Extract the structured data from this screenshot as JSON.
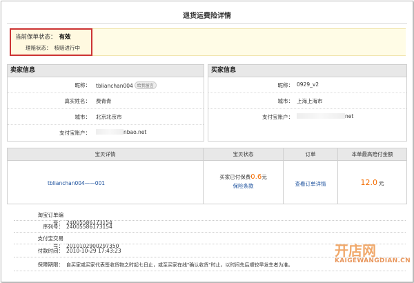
{
  "page": {
    "title": "退货运费险详情"
  },
  "policy_status": {
    "label": "当前保单状态：",
    "value": "有效",
    "claim_label": "理赔状态：",
    "claim_value": "核赔进行中"
  },
  "seller": {
    "heading": "卖家信息",
    "rows": [
      {
        "label": "昵称：",
        "value": "tblianchan004",
        "badge": "给我留言"
      },
      {
        "label": "真实姓名：",
        "value": "费青青"
      },
      {
        "label": "城市：",
        "value": "北京北京市"
      },
      {
        "label": "支付宝账户：",
        "value": "nbao.net"
      }
    ]
  },
  "buyer": {
    "heading": "买家信息",
    "rows": [
      {
        "label": "昵称：",
        "value": "0929_v2"
      },
      {
        "label": "城市：",
        "value": "上海上海市"
      },
      {
        "label": "支付宝账户：",
        "value": "net"
      }
    ]
  },
  "goods": {
    "headers": [
      "宝贝详情",
      "宝贝状态",
      "订单",
      "本单最高赔付金额"
    ],
    "item_name": "tblianchan004——001",
    "status_prefix": "买家已付保费",
    "premium": "0.6",
    "premium_unit": "元",
    "terms_link": "保险条款",
    "order_link": "查看订单详情",
    "max_payout": "12.0",
    "payout_unit": "元"
  },
  "details": [
    {
      "key": "淘宝订单编号：",
      "value": "24005586173154"
    },
    {
      "key": "序列号：",
      "value": "24005586173154"
    },
    {
      "key": "支付宝交易号：",
      "value": "2010102900297350"
    },
    {
      "key": "付款时间：",
      "value": "2010-10-29 17:43:23"
    },
    {
      "key": "保障期限：",
      "value": "自买家或买家代表签收货物之时起七日止，或至买家在线\"确认收货\"时止，以时间先后顺较早发生者为准。"
    }
  ],
  "watermark": {
    "logo": "开店网",
    "site": "KAIGEWANGDIAN.CN"
  },
  "colors": {
    "accent_orange": "#f36c00",
    "link_blue": "#1a4f9c",
    "status_border": "#cc3333"
  }
}
